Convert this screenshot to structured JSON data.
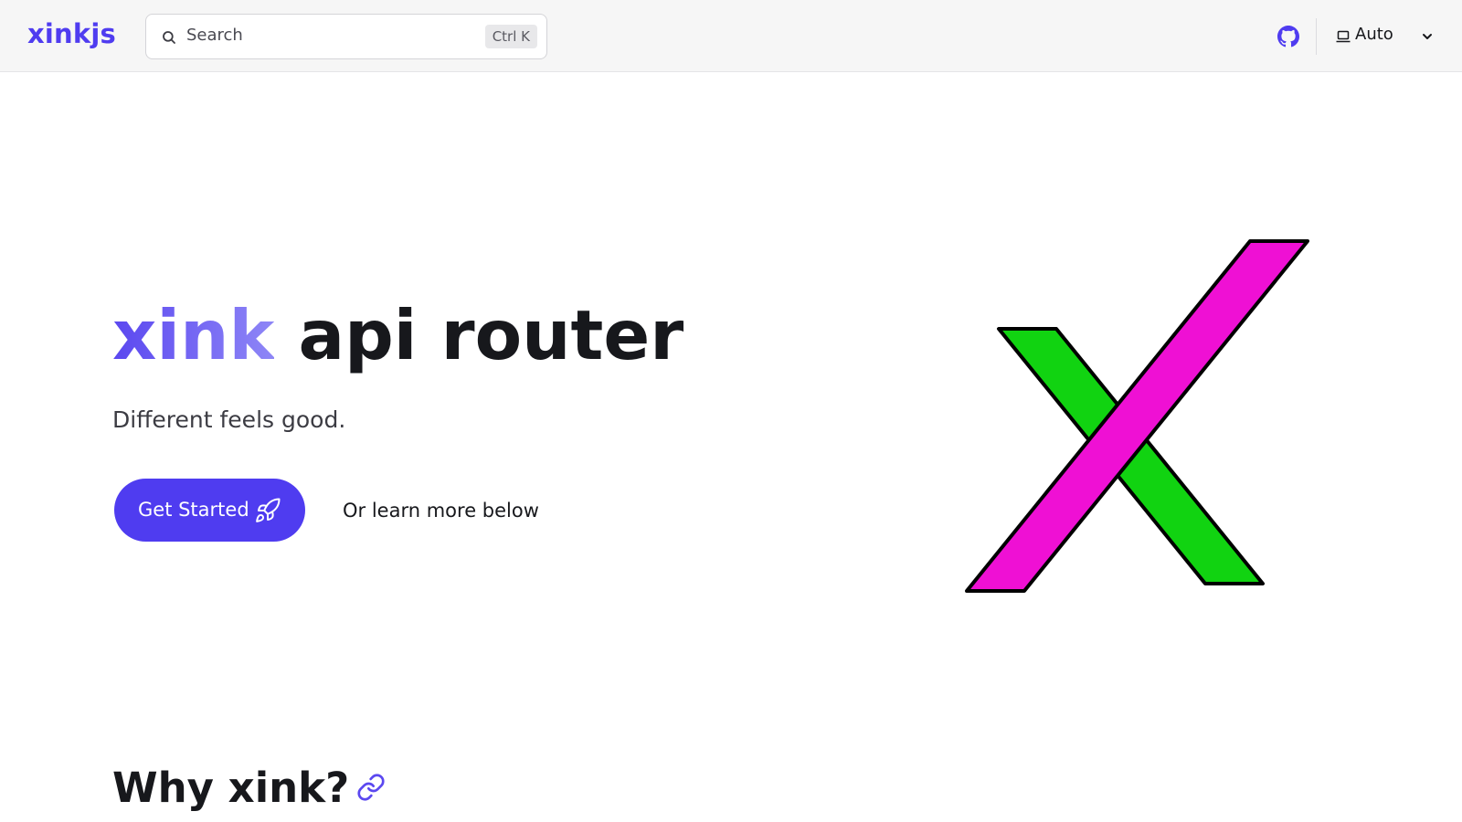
{
  "header": {
    "logo": "xinkjs",
    "search": {
      "placeholder": "Search",
      "shortcut": "Ctrl K"
    },
    "github_icon": "github-icon",
    "theme": {
      "icon": "laptop-icon",
      "label": "Auto"
    }
  },
  "hero": {
    "title_brand": "xink",
    "title_rest": " api router",
    "tagline": "Different feels good.",
    "cta_label": "Get Started",
    "cta_icon": "rocket-icon",
    "secondary_link": "Or learn more below"
  },
  "logo_graphic": {
    "colors": {
      "green": "#11d311",
      "magenta": "#ef10d4",
      "outline": "#000000"
    }
  },
  "section": {
    "title": "Why xink?",
    "anchor_icon": "link-icon"
  },
  "colors": {
    "accent": "#4f3cf0",
    "header_bg": "#f6f6f6",
    "text": "#17181c"
  }
}
